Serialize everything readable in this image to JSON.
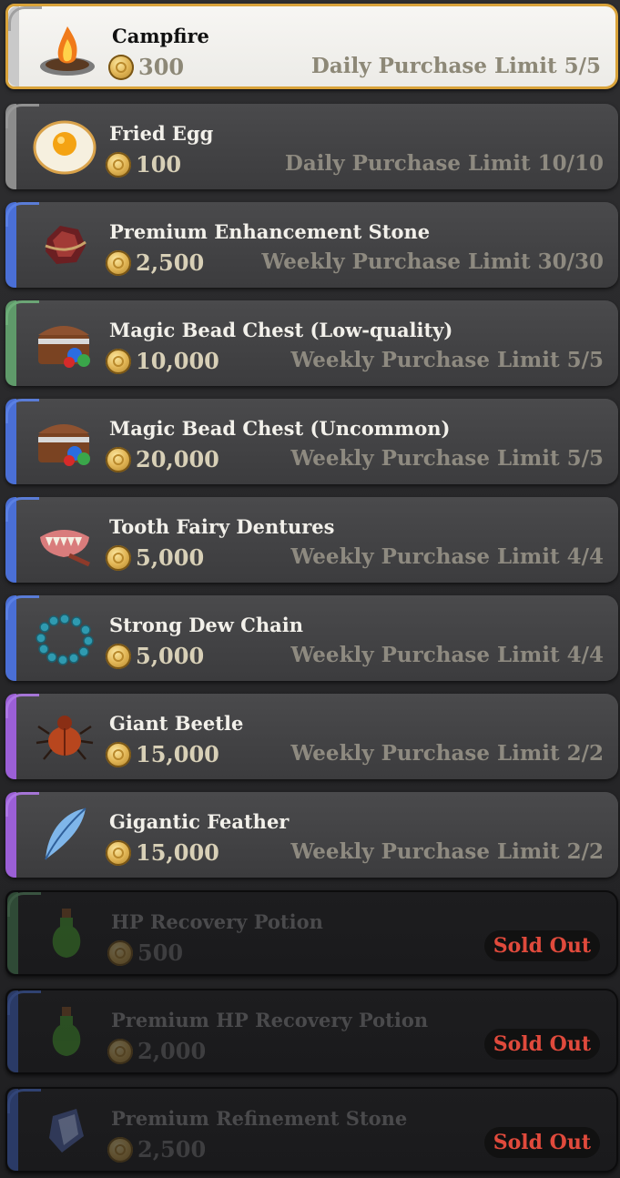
{
  "shop": {
    "items": [
      {
        "title": "Campfire",
        "price": "300",
        "limit": "Daily Purchase Limit 5/5",
        "icon": "campfire-icon"
      },
      {
        "title": "Fried Egg",
        "price": "100",
        "limit": "Daily Purchase Limit 10/10",
        "icon": "fried-egg-icon"
      },
      {
        "title": "Premium Enhancement Stone",
        "price": "2,500",
        "limit": "Weekly Purchase Limit 30/30",
        "icon": "enhancement-stone-icon"
      },
      {
        "title": "Magic Bead Chest (Low-quality)",
        "price": "10,000",
        "limit": "Weekly Purchase Limit 5/5",
        "icon": "treasure-chest-icon"
      },
      {
        "title": "Magic Bead Chest (Uncommon)",
        "price": "20,000",
        "limit": "Weekly Purchase Limit 5/5",
        "icon": "treasure-chest-icon"
      },
      {
        "title": "Tooth Fairy Dentures",
        "price": "5,000",
        "limit": "Weekly Purchase Limit 4/4",
        "icon": "dentures-icon"
      },
      {
        "title": "Strong Dew Chain",
        "price": "5,000",
        "limit": "Weekly Purchase Limit 4/4",
        "icon": "bead-chain-icon"
      },
      {
        "title": "Giant Beetle",
        "price": "15,000",
        "limit": "Weekly Purchase Limit 2/2",
        "icon": "beetle-icon"
      },
      {
        "title": "Gigantic Feather",
        "price": "15,000",
        "limit": "Weekly Purchase Limit 2/2",
        "icon": "feather-icon"
      },
      {
        "title": "HP Recovery Potion",
        "price": "500",
        "sold_label": "Sold Out",
        "icon": "potion-icon"
      },
      {
        "title": "Premium HP Recovery Potion",
        "price": "2,000",
        "sold_label": "Sold Out",
        "icon": "potion-icon"
      },
      {
        "title": "Premium Refinement Stone",
        "price": "2,500",
        "sold_label": "Sold Out",
        "icon": "refinement-stone-icon"
      }
    ]
  },
  "colors": {
    "selected_border": "#d9a33a",
    "sold_out_text": "#e04a3c",
    "accent_gray": "#8a8a8a",
    "accent_blue": "#4a6fd6",
    "accent_green": "#5f9a6a",
    "accent_purple": "#9b5fd6"
  }
}
